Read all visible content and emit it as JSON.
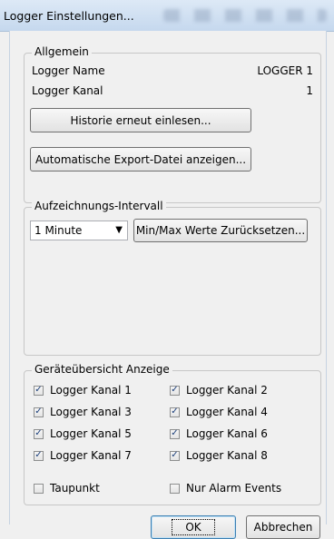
{
  "window": {
    "title": "Logger Einstellungen..."
  },
  "allgemein": {
    "legend": "Allgemein",
    "logger_name_label": "Logger Name",
    "logger_name_value": "LOGGER 1",
    "logger_kanal_label": "Logger Kanal",
    "logger_kanal_value": "1",
    "historie_button": "Historie erneut einlesen...",
    "export_button": "Automatische Export-Datei anzeigen..."
  },
  "intervall": {
    "legend": "Aufzeichnungs-Intervall",
    "selected": "1 Minute",
    "reset_button": "Min/Max Werte Zurücksetzen..."
  },
  "anzeige": {
    "legend": "Geräteübersicht Anzeige",
    "checks": [
      {
        "label": "Logger Kanal 1",
        "checked": true
      },
      {
        "label": "Logger Kanal 2",
        "checked": true
      },
      {
        "label": "Logger Kanal 3",
        "checked": true
      },
      {
        "label": "Logger Kanal 4",
        "checked": true
      },
      {
        "label": "Logger Kanal 5",
        "checked": true
      },
      {
        "label": "Logger Kanal 6",
        "checked": true
      },
      {
        "label": "Logger Kanal 7",
        "checked": true
      },
      {
        "label": "Logger Kanal 8",
        "checked": true
      },
      {
        "label": "Taupunkt",
        "checked": false
      },
      {
        "label": "Nur Alarm Events",
        "checked": false
      }
    ]
  },
  "footer": {
    "ok": "OK",
    "cancel": "Abbrechen"
  },
  "icons": {
    "checkmark": "check-icon",
    "dropdown": "chevron-down-icon"
  }
}
